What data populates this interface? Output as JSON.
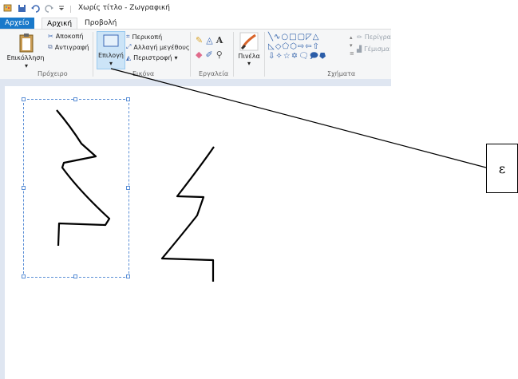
{
  "window": {
    "title": "Χωρίς τίτλο - Ζωγραφική",
    "tabs": [
      {
        "label": "Αρχείο"
      },
      {
        "label": "Αρχική"
      },
      {
        "label": "Προβολή"
      }
    ]
  },
  "ribbon": {
    "clipboard": {
      "paste_label": "Επικόλληση",
      "cut_label": "Αποκοπή",
      "copy_label": "Αντιγραφή",
      "group_label": "Πρόχειρο"
    },
    "image": {
      "select_label": "Επιλογή",
      "crop_label": "Περικοπή",
      "resize_label": "Αλλαγή μεγέθους",
      "rotate_label": "Περιστροφή",
      "group_label": "Εικόνα"
    },
    "tools": {
      "group_label": "Εργαλεία",
      "text_tool": "A"
    },
    "brushes": {
      "label": "Πινέλα"
    },
    "shapes": {
      "group_label": "Σχήματα",
      "outline_label": "Περίγρα",
      "fill_label": "Γέμισμα",
      "row1": "╲∿○□▢◸△",
      "row2": "◺◇⬠⬡⇨⇦⇧",
      "row3": "⇩✧☆✡🗨🗩⯂"
    }
  },
  "annotation": {
    "label": "ε"
  },
  "colors": {
    "file_tab": "#1979ca",
    "ribbon_bg": "#f5f6f7",
    "canvas_bg": "#dfe6f1",
    "selection": "#5b8fd6"
  }
}
